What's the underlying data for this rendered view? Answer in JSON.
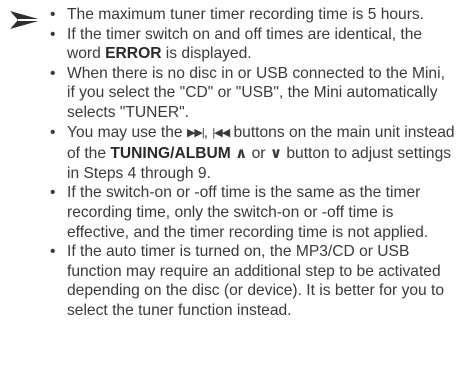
{
  "top_cutoff": "",
  "icons": {
    "pointer": "right-pointer-arrow-icon",
    "bullet": "bullet-dot"
  },
  "notes": [
    {
      "text": "The maximum tuner timer recording time is 5 hours."
    },
    {
      "before": "If the timer switch on and off times are identical, the word ",
      "bold": "ERROR",
      "after": " is displayed."
    },
    {
      "text": "When there is no disc in or USB connected to the Mini, if you select the \"CD\" or \"USB\", the Mini automatically selects \"TUNER\"."
    },
    {
      "part1": "You may use the ",
      "next_glyph": "▶▶|",
      "sep": ", ",
      "prev_glyph": "|◀◀",
      "part2": " buttons on the main unit instead of the ",
      "bold": "TUNING/ALBUM",
      "up_caret": "∧",
      "or_text": " or ",
      "down_caret": "∨",
      "part3": " button to adjust settings in Steps 4 through 9."
    },
    {
      "text": "If the switch-on or -off time is the same as the timer recording  time, only the switch-on or -off time is effective, and the timer recording time is not applied."
    },
    {
      "text": "If the auto timer is turned on, the MP3/CD or USB function may require an additional step to be activated depending on the disc (or device). It is better for you to select the tuner function instead."
    }
  ]
}
